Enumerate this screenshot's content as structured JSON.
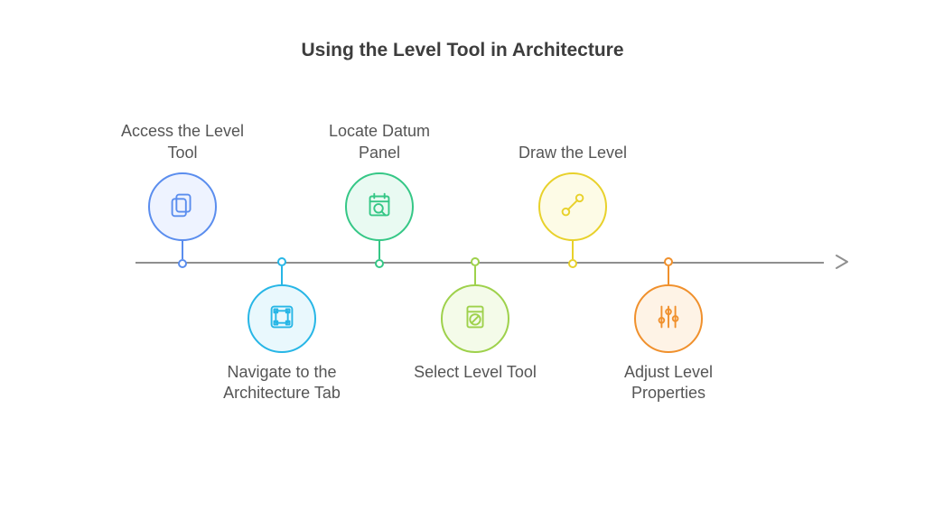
{
  "title": "Using the Level Tool in Architecture",
  "steps": [
    {
      "label": "Access the Level Tool",
      "icon": "copy-icon",
      "color": "blue",
      "placement": "above"
    },
    {
      "label": "Navigate to the Architecture Tab",
      "icon": "transform-icon",
      "color": "cyan",
      "placement": "below"
    },
    {
      "label": "Locate Datum Panel",
      "icon": "calendar-search-icon",
      "color": "green",
      "placement": "above"
    },
    {
      "label": "Select Level Tool",
      "icon": "not-allowed-icon",
      "color": "lime",
      "placement": "below"
    },
    {
      "label": "Draw the Level",
      "icon": "line-segment-icon",
      "color": "yellow",
      "placement": "above"
    },
    {
      "label": "Adjust Level Properties",
      "icon": "sliders-icon",
      "color": "orange",
      "placement": "below"
    }
  ]
}
